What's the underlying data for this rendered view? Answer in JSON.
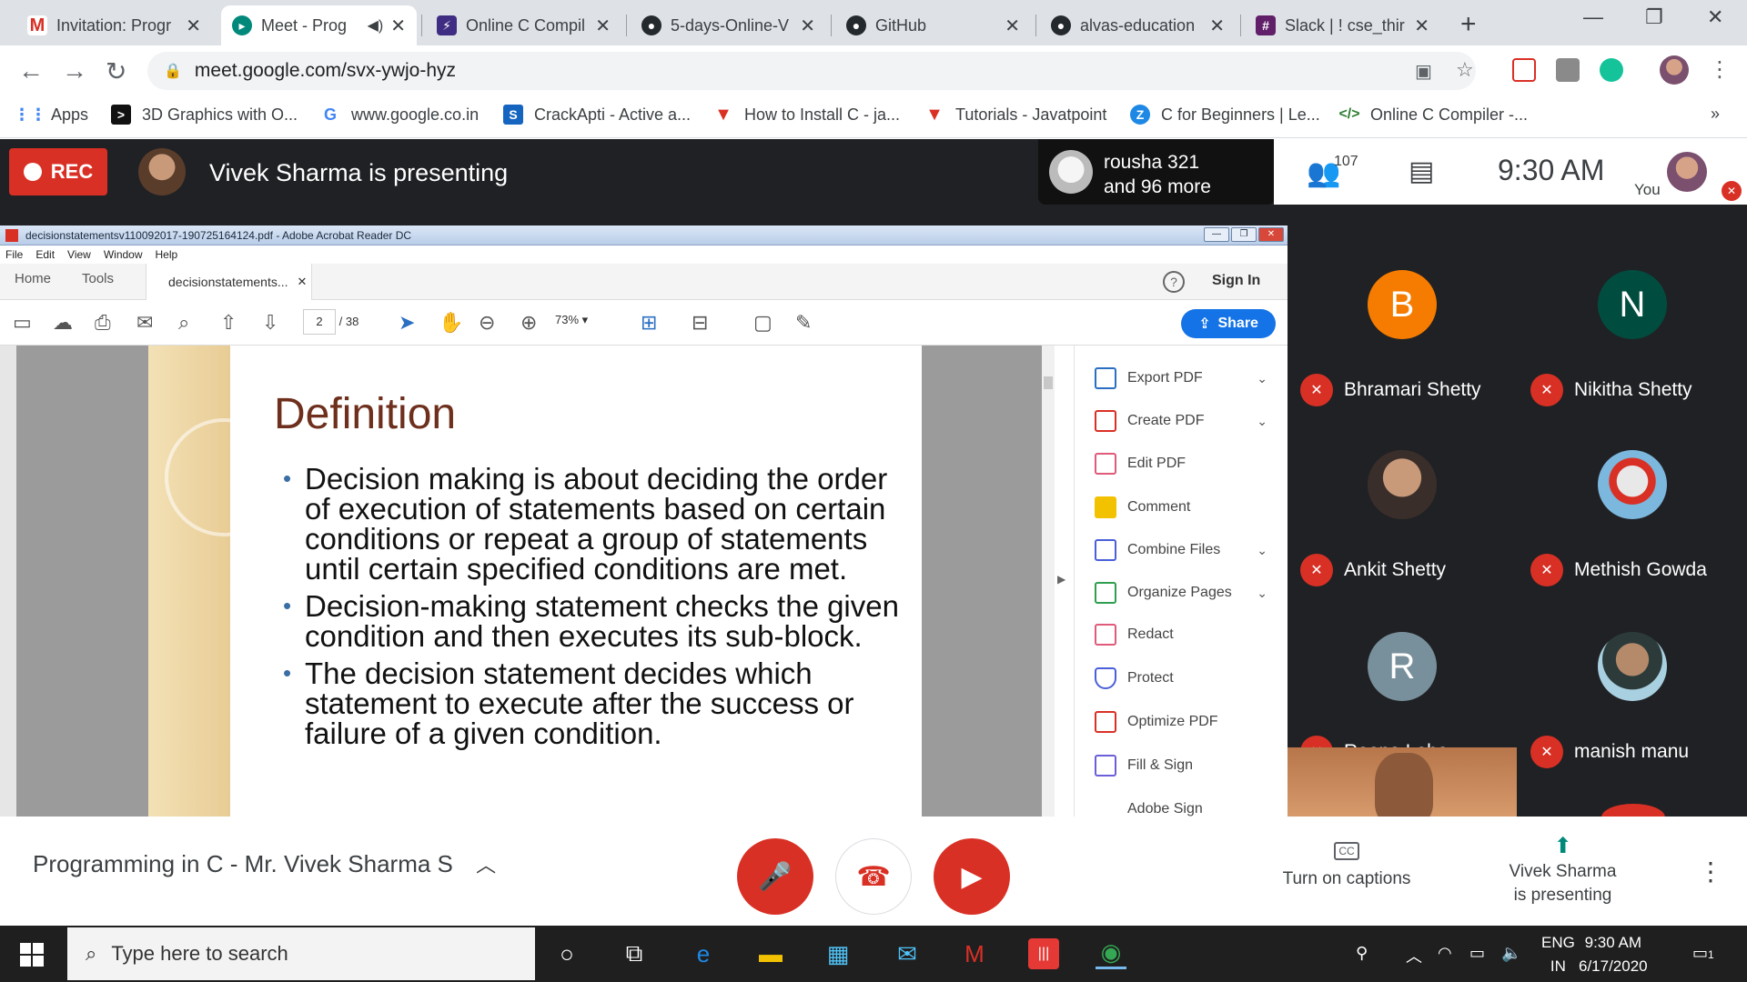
{
  "browser": {
    "tabs": [
      {
        "title": "Invitation: Progr",
        "favicon": "gmail-icon"
      },
      {
        "title": "Meet - Prog",
        "favicon": "meet-icon"
      },
      {
        "title": "Online C Compil",
        "favicon": "bolt-icon"
      },
      {
        "title": "5-days-Online-V",
        "favicon": "github-icon"
      },
      {
        "title": "GitHub",
        "favicon": "github-icon"
      },
      {
        "title": "alvas-education",
        "favicon": "github-icon"
      },
      {
        "title": "Slack | ! cse_thir",
        "favicon": "slack-icon"
      }
    ],
    "url": "meet.google.com/svx-ywjo-hyz",
    "bookmarks": [
      "Apps",
      "3D Graphics with O...",
      "www.google.co.in",
      "CrackApti - Active a...",
      "How to Install C - ja...",
      "Tutorials - Javatpoint",
      "C for Beginners | Le...",
      "Online C Compiler -..."
    ],
    "bookmarks_overflow": "»"
  },
  "meet": {
    "rec_label": "REC",
    "presenting_banner": "Vivek Sharma is presenting",
    "others_name": "rousha 321",
    "others_more": "and 96 more",
    "participant_count": "107",
    "time": "9:30  AM",
    "you_label": "You",
    "participants": [
      {
        "initial": "B",
        "name": "Bhramari Shetty",
        "color": "#f57c00"
      },
      {
        "initial": "N",
        "name": "Nikitha Shetty",
        "color": "#004d40"
      },
      {
        "initial": "",
        "name": "Ankit Shetty",
        "color": "#c9a48c"
      },
      {
        "initial": "",
        "name": "Methish Gowda",
        "color": "#8fb9d6"
      },
      {
        "initial": "R",
        "name": "Reena Lobo",
        "color": "#78909c"
      },
      {
        "initial": "",
        "name": "manish manu",
        "color": "#6b8a78"
      }
    ],
    "meeting_title": "Programming in C - Mr. Vivek Sharma S",
    "captions_label": "Turn on captions",
    "captions_icon": "CC",
    "presenting_line1": "Vivek Sharma",
    "presenting_line2": "is presenting"
  },
  "acrobat": {
    "window_title": "decisionstatementsv110092017-190725164124.pdf - Adobe Acrobat Reader DC",
    "menu": [
      "File",
      "Edit",
      "View",
      "Window",
      "Help"
    ],
    "home_tab": "Home",
    "tools_tab": "Tools",
    "doc_tab": "decisionstatements...",
    "sign_in": "Sign In",
    "page_current": "2",
    "page_total": "/ 38",
    "zoom": "73%",
    "share": "Share",
    "tools_panel": [
      {
        "label": "Export PDF",
        "color": "#2b6fc2",
        "expand": true
      },
      {
        "label": "Create PDF",
        "color": "#d93025",
        "expand": true
      },
      {
        "label": "Edit PDF",
        "color": "#e05a7a",
        "expand": false
      },
      {
        "label": "Comment",
        "color": "#f2c200",
        "expand": false
      },
      {
        "label": "Combine Files",
        "color": "#4a5fd9",
        "expand": true
      },
      {
        "label": "Organize Pages",
        "color": "#2e9e4f",
        "expand": true
      },
      {
        "label": "Redact",
        "color": "#e05a7a",
        "expand": false
      },
      {
        "label": "Protect",
        "color": "#4a5fd9",
        "expand": false
      },
      {
        "label": "Optimize PDF",
        "color": "#d93025",
        "expand": false
      },
      {
        "label": "Fill & Sign",
        "color": "#6b5fd9",
        "expand": false
      },
      {
        "label": "Adobe Sign",
        "color": "#6b5fd9",
        "expand": false
      }
    ]
  },
  "slide": {
    "heading": "Definition",
    "bullets": [
      "Decision making is about deciding the order of execution of statements based on certain conditions or repeat a group of statements until certain specified conditions are met.",
      "Decision-making statement checks the given condition and then executes its sub-block.",
      "The decision statement decides which statement to execute after the success or failure of a given condition."
    ]
  },
  "taskbar": {
    "search_placeholder": "Type here to search",
    "lang_top": "ENG",
    "lang_bottom": "IN",
    "time": "9:30 AM",
    "date": "6/17/2020",
    "notification_count": "1"
  }
}
